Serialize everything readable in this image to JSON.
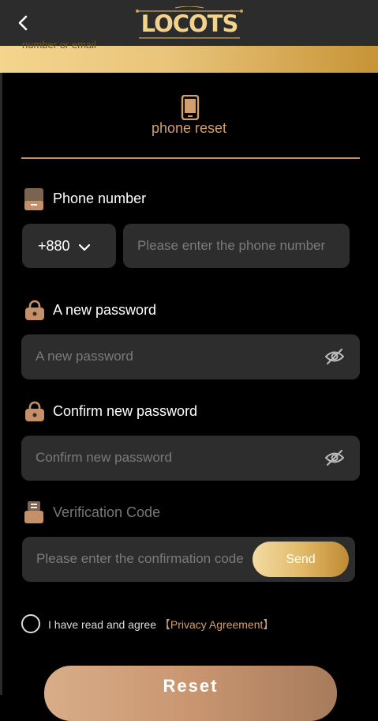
{
  "header": {
    "logo_text": "LOCOTS",
    "banner_text": "number or email"
  },
  "tab": {
    "label": "phone reset"
  },
  "phone": {
    "label": "Phone number",
    "country_code": "+880",
    "placeholder": "Please enter the phone number"
  },
  "new_password": {
    "label": "A new password",
    "placeholder": "A new password"
  },
  "confirm_password": {
    "label": "Confirm new password",
    "placeholder": "Confirm new password"
  },
  "verification": {
    "label": "Verification Code",
    "placeholder": "Please enter the confirmation code",
    "send_label": "Send"
  },
  "agreement": {
    "text": "I have read and agree",
    "link": "【Privacy Agreement】"
  },
  "reset_label": "Reset",
  "colors": {
    "accent": "#d39f6d",
    "gold": "#e2bb6a",
    "field_bg": "#2d2d2d",
    "background": "#000000"
  }
}
